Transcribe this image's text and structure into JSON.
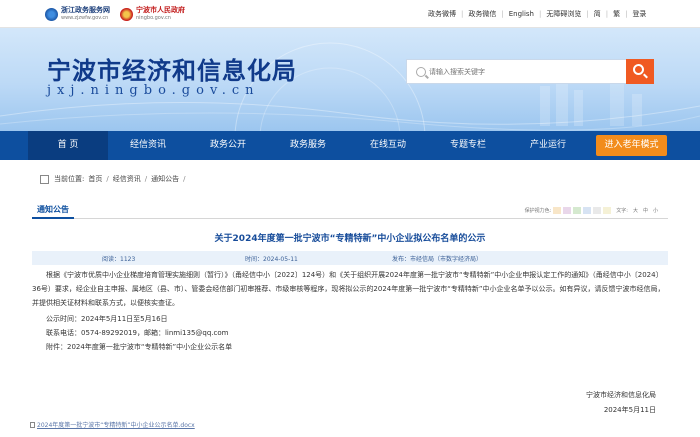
{
  "topbar": {
    "logo1_name": "浙江政务服务网",
    "logo1_url": "www.zjzwfw.gov.cn",
    "logo2_name": "宁波市人民政府",
    "logo2_url": "ningbo.gov.cn",
    "links": [
      "政务微博",
      "政务微信",
      "English",
      "无障碍浏览",
      "简",
      "繁",
      "登录"
    ]
  },
  "banner": {
    "title": "宁波市经济和信息化局",
    "url_text": "jxj.ningbo.gov.cn",
    "search_placeholder": "请输入搜索关键字"
  },
  "nav": {
    "items": [
      "首  页",
      "经信资讯",
      "政务公开",
      "政务服务",
      "在线互动",
      "专题专栏",
      "产业运行"
    ],
    "active_index": 0,
    "elder_mode": "进入老年模式"
  },
  "breadcrumb": {
    "prefix": "当前位置:",
    "items": [
      "首页",
      "经信资讯",
      "通知公告"
    ]
  },
  "section": {
    "tab": "通知公告",
    "tools_label": "保护视力色:",
    "font_label": "文字:",
    "font_sizes": [
      "大",
      "中",
      "小"
    ],
    "swatches": [
      "#f8e6c8",
      "#e9d7ea",
      "#d5e9cf",
      "#d7e3f3",
      "#e9e9e9",
      "#f5f1d6"
    ]
  },
  "article": {
    "title": "关于2024年度第一批宁波市“专精特新”中小企业拟公布名单的公示",
    "reads": "阅读：1123",
    "time": "时间：2024-05-11",
    "publisher": "发布：市经信局（市数字经济局）",
    "para1": "根据《宁波市优质中小企业梯度培育管理实施细则（暂行）》（甬经信中小〔2022〕124号）和《关于组织开展2024年度第一批宁波市“专精特新”中小企业申报认定工作的通知》（甬经信中小〔2024〕36号）要求，经企业自主申报、属地区（县、市）、管委会经信部门初审推荐、市级审核等程序，现将拟公示的2024年度第一批宁波市“专精特新”中小企业名单予以公示。如有异议，请反馈宁波市经信局，并提供相关证材料和联系方式，以便核实查证。",
    "period": "公示时间：2024年5月11日至5月16日",
    "contact": "联系电话：0574-89292019，邮箱：linmi135@qq.com",
    "attachment_line": "附件：2024年度第一批宁波市“专精特新”中小企业公示名单",
    "signer": "宁波市经济和信息化局",
    "date": "2024年5月11日",
    "attachment_file": "2024年度第一批宁波市“专精特新”中小企业公示名单.docx"
  }
}
